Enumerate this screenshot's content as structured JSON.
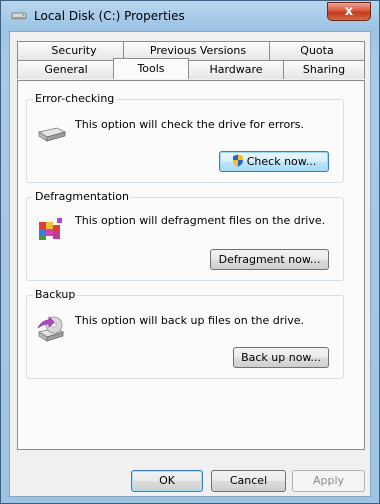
{
  "window": {
    "title": "Local Disk (C:) Properties",
    "close_glyph": "x"
  },
  "tabs": {
    "row_back": [
      "Security",
      "Previous Versions",
      "Quota"
    ],
    "row_front": [
      "General",
      "Tools",
      "Hardware",
      "Sharing"
    ],
    "active": "Tools"
  },
  "groups": {
    "error_checking": {
      "label": "Error-checking",
      "text": "This option will check the drive for errors.",
      "button": "Check now...",
      "icon": "drive-icon"
    },
    "defragmentation": {
      "label": "Defragmentation",
      "text": "This option will defragment files on the drive.",
      "button": "Defragment now...",
      "icon": "defragment-icon"
    },
    "backup": {
      "label": "Backup",
      "text": "This option will back up files on the drive.",
      "button": "Back up now...",
      "icon": "backup-icon"
    }
  },
  "footer": {
    "ok": "OK",
    "cancel": "Cancel",
    "apply": "Apply"
  }
}
